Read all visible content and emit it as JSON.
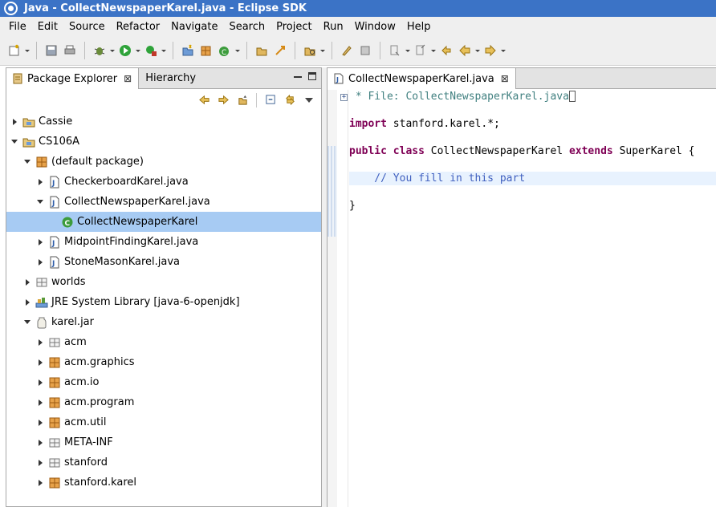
{
  "window": {
    "title": "Java - CollectNewspaperKarel.java - Eclipse SDK"
  },
  "menubar": {
    "items": [
      "File",
      "Edit",
      "Source",
      "Refactor",
      "Navigate",
      "Search",
      "Project",
      "Run",
      "Window",
      "Help"
    ]
  },
  "package_explorer": {
    "tabs": [
      {
        "label": "Package Explorer",
        "close": "⊠"
      },
      {
        "label": "Hierarchy"
      }
    ],
    "tree": [
      {
        "label": "Cassie",
        "icon": "project-folder-icon",
        "depth": 0,
        "expanded": false
      },
      {
        "label": "CS106A",
        "icon": "project-folder-icon",
        "depth": 0,
        "expanded": true
      },
      {
        "label": "(default package)",
        "icon": "package-icon",
        "depth": 1,
        "expanded": true
      },
      {
        "label": "CheckerboardKarel.java",
        "icon": "java-file-icon",
        "depth": 2,
        "expanded": false
      },
      {
        "label": "CollectNewspaperKarel.java",
        "icon": "java-file-icon",
        "depth": 2,
        "expanded": true
      },
      {
        "label": "CollectNewspaperKarel",
        "icon": "class-icon",
        "depth": 3,
        "selected": true
      },
      {
        "label": "MidpointFindingKarel.java",
        "icon": "java-file-icon",
        "depth": 2,
        "expanded": false
      },
      {
        "label": "StoneMasonKarel.java",
        "icon": "java-file-icon",
        "depth": 2,
        "expanded": false
      },
      {
        "label": "worlds",
        "icon": "folder-package-icon",
        "depth": 1,
        "expanded": false
      },
      {
        "label": "JRE System Library [java-6-openjdk]",
        "icon": "library-icon",
        "depth": 1,
        "expanded": false
      },
      {
        "label": "karel.jar",
        "icon": "jar-icon",
        "depth": 1,
        "expanded": true
      },
      {
        "label": "acm",
        "icon": "folder-package-icon",
        "depth": 2,
        "expanded": false
      },
      {
        "label": "acm.graphics",
        "icon": "package-icon",
        "depth": 2,
        "expanded": false
      },
      {
        "label": "acm.io",
        "icon": "package-icon",
        "depth": 2,
        "expanded": false
      },
      {
        "label": "acm.program",
        "icon": "package-icon",
        "depth": 2,
        "expanded": false
      },
      {
        "label": "acm.util",
        "icon": "package-icon",
        "depth": 2,
        "expanded": false
      },
      {
        "label": "META-INF",
        "icon": "folder-package-icon",
        "depth": 2,
        "expanded": false
      },
      {
        "label": "stanford",
        "icon": "folder-package-icon",
        "depth": 2,
        "expanded": false
      },
      {
        "label": "stanford.karel",
        "icon": "package-icon",
        "depth": 2,
        "expanded": false
      }
    ]
  },
  "editor": {
    "tab": {
      "label": "CollectNewspaperKarel.java",
      "close": "⊠"
    },
    "fold_marker": "+",
    "lines": [
      [
        {
          "t": " * File: CollectNewspaperKarel.java",
          "c": "cm"
        }
      ],
      [],
      [
        {
          "t": "import",
          "c": "kw"
        },
        {
          "t": " stanford.karel.*;"
        }
      ],
      [],
      [
        {
          "t": "public",
          "c": "kw"
        },
        {
          "t": " "
        },
        {
          "t": "class",
          "c": "kw"
        },
        {
          "t": " CollectNewspaperKarel "
        },
        {
          "t": "extends",
          "c": "kw"
        },
        {
          "t": " SuperKarel {"
        }
      ],
      [],
      [
        {
          "t": "    // You fill in this part",
          "c": "dc"
        }
      ],
      [],
      [
        {
          "t": "}"
        }
      ]
    ]
  },
  "colors": {
    "titlebar": "#3b73c6",
    "selection": "#a7cbf3",
    "keyword": "#7f0055",
    "comment": "#3f7f7f",
    "current_line": "#e8f2fe"
  }
}
